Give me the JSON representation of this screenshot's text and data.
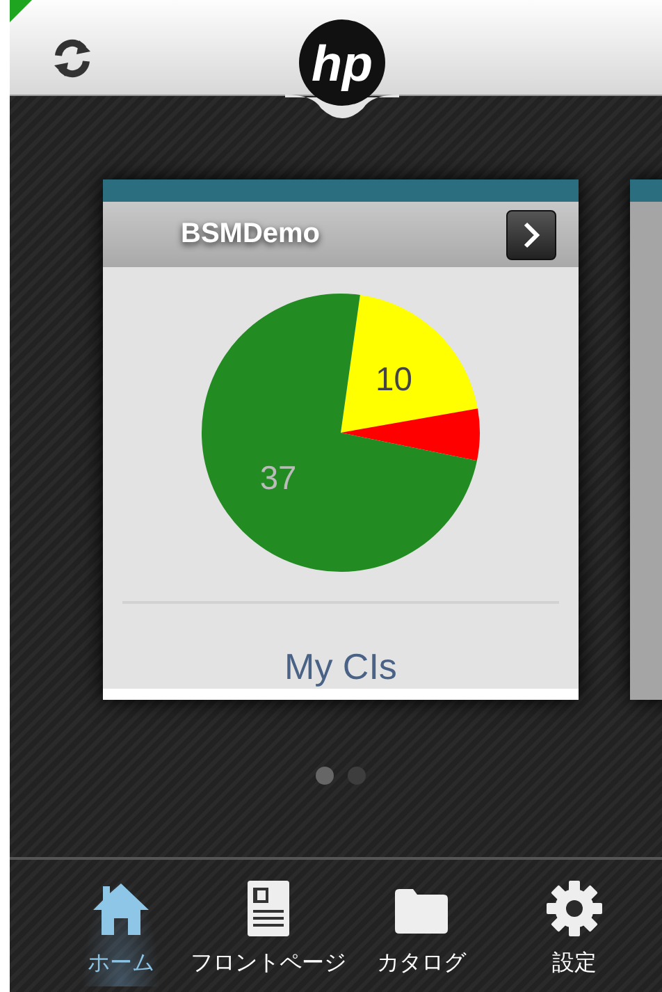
{
  "header": {
    "logo": "hp"
  },
  "card": {
    "title": "BSMDemo",
    "chart_data": {
      "type": "pie",
      "values": [
        10,
        3,
        37
      ],
      "colors": [
        "#ffff00",
        "#ff0000",
        "#228b22"
      ],
      "value_labels": [
        "10",
        null,
        "37"
      ]
    },
    "footer": "My CIs"
  },
  "pager": [
    {
      "selected": true
    },
    {
      "selected": false
    }
  ],
  "tabs": [
    {
      "kind": "home",
      "label": "ホーム",
      "selected": true
    },
    {
      "kind": "frontpage",
      "label": "フロントページ",
      "selected": false
    },
    {
      "kind": "catalog",
      "label": "カタログ",
      "selected": false
    },
    {
      "kind": "settings",
      "label": "設定",
      "selected": false
    }
  ]
}
